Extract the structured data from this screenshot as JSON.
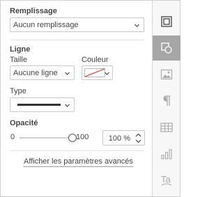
{
  "fill": {
    "heading": "Remplissage",
    "selected": "Aucun remplissage"
  },
  "line": {
    "heading": "Ligne",
    "size_label": "Taille",
    "size_selected": "Aucune ligne",
    "color_label": "Couleur",
    "color_value": "none",
    "type_label": "Type",
    "type_selected": "solid"
  },
  "opacity": {
    "heading": "Opacité",
    "min_label": "0",
    "max_label": "100",
    "value": "100 %",
    "slider_level": 1.0
  },
  "advanced_link": "Afficher les paramètres avancés",
  "sidebar": {
    "items": [
      {
        "name": "slide-settings-icon",
        "active": false
      },
      {
        "name": "shape-settings-icon",
        "active": true
      },
      {
        "name": "image-settings-icon",
        "active": false
      },
      {
        "name": "paragraph-settings-icon",
        "active": false
      },
      {
        "name": "table-settings-icon",
        "active": false
      },
      {
        "name": "chart-settings-icon",
        "active": false
      },
      {
        "name": "text-art-settings-icon",
        "active": false
      }
    ]
  },
  "colors": {
    "active_tab": "#a6a6a6",
    "no_color_slash": "#e0322f",
    "border": "#c8c8c8"
  }
}
